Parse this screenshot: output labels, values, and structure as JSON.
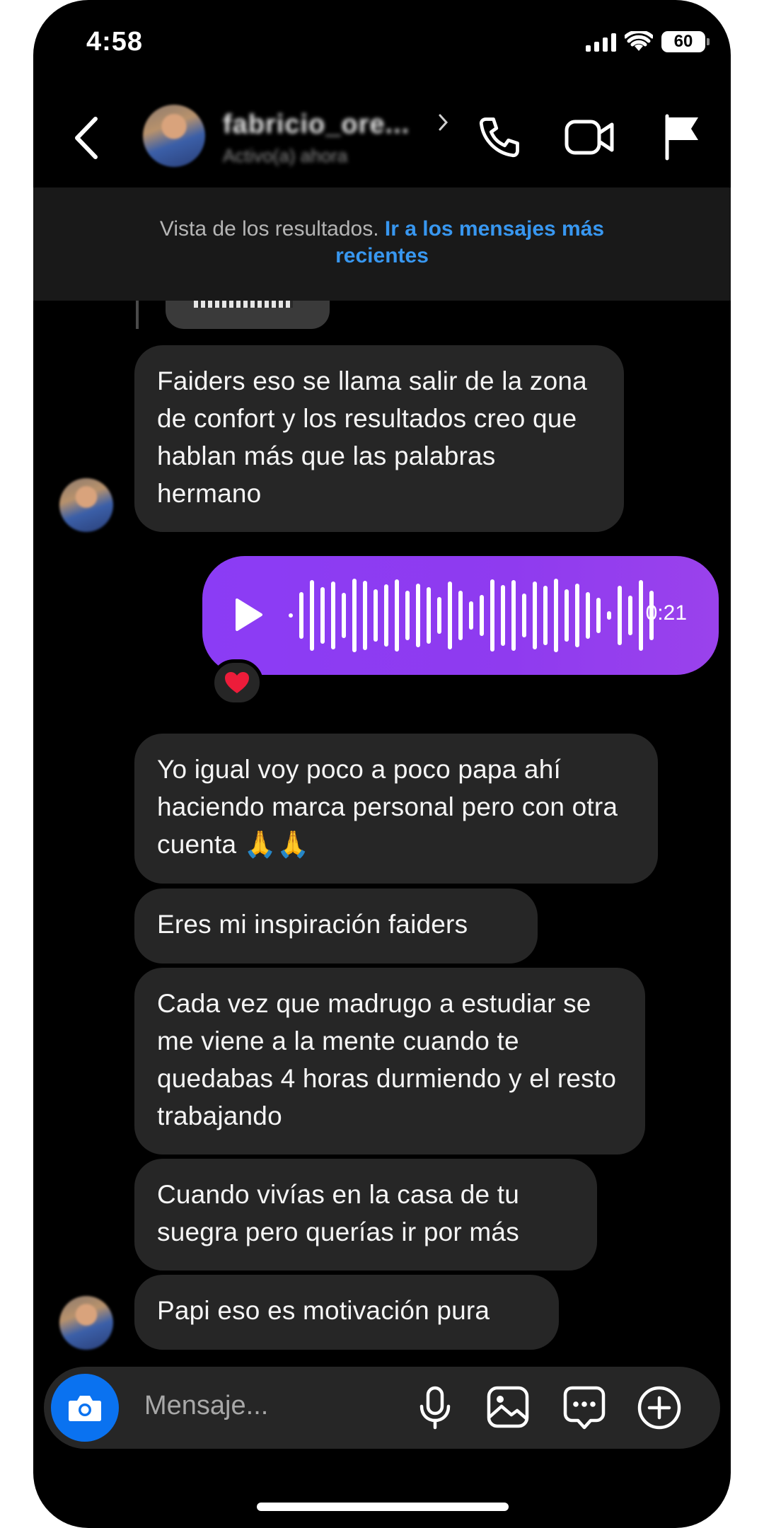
{
  "status_bar": {
    "time": "4:58",
    "battery": "60"
  },
  "header": {
    "username": "fabricio_ore...",
    "status": "Activo(a) ahora",
    "icons": [
      "back-arrow-icon",
      "chevron-right-icon",
      "phone-icon",
      "video-camera-icon",
      "flag-icon"
    ]
  },
  "banner": {
    "text": "Vista de los resultados. ",
    "link": "Ir a los mensajes más recientes"
  },
  "messages": [
    {
      "from": "other",
      "text": "Faiders eso se llama salir de la zona de confort y los resultados creo que hablan más que las palabras hermano"
    },
    {
      "from": "me",
      "type": "voice",
      "duration": "0:21",
      "reaction": "❤️"
    },
    {
      "from": "other",
      "text": "Yo igual voy poco a poco papa ahí haciendo marca personal pero con otra cuenta 🙏🙏"
    },
    {
      "from": "other",
      "text": "Eres mi inspiración faiders"
    },
    {
      "from": "other",
      "text": "Cada vez que madrugo a estudiar se me viene a la mente cuando te quedabas 4 horas durmiendo y el resto trabajando"
    },
    {
      "from": "other",
      "text": "Cuando vivías en la casa de tu suegra pero querías ir por más"
    },
    {
      "from": "other",
      "text": "Papi eso es motivación pura"
    }
  ],
  "composer": {
    "placeholder": "Mensaje...",
    "icons": [
      "camera-icon",
      "microphone-icon",
      "gallery-icon",
      "sticker-chat-icon",
      "plus-circle-icon"
    ]
  },
  "colors": {
    "background": "#000000",
    "bubble_other": "#262626",
    "bubble_me": "#8b3cf5",
    "link": "#3897f0",
    "camera_button": "#0a72f0"
  }
}
